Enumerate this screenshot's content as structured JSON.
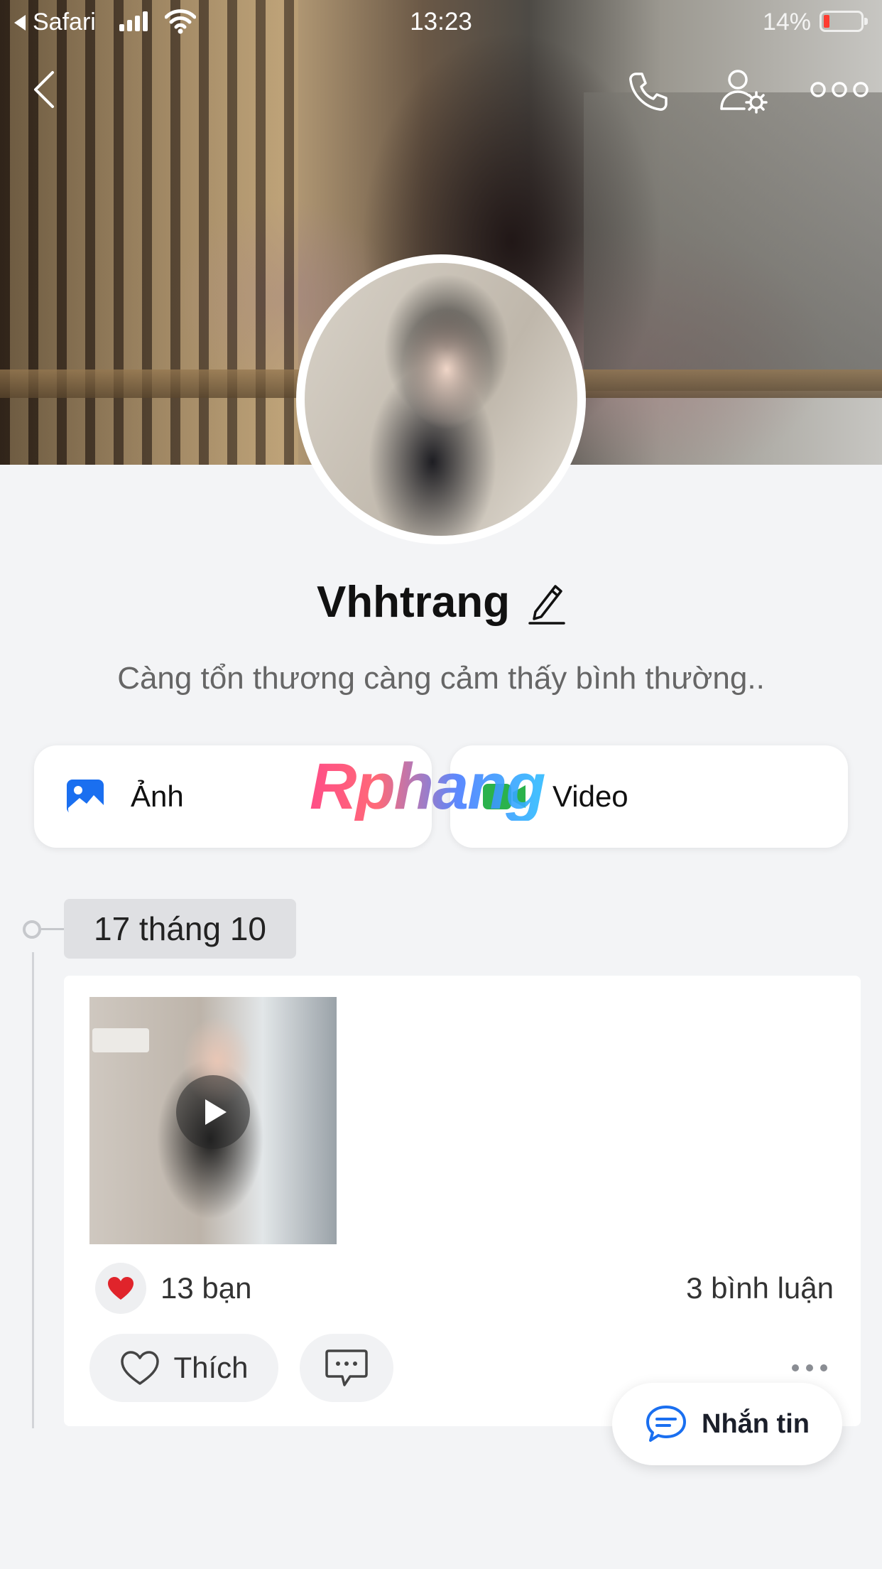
{
  "status_bar": {
    "back_app": "Safari",
    "time": "13:23",
    "battery_percent": "14%",
    "battery_level": 0.14
  },
  "nav": {
    "back_icon": "chevron-left-icon",
    "call_icon": "phone-icon",
    "settings_icon": "person-gear-icon",
    "more_icon": "more-dots-icon"
  },
  "profile": {
    "name": "Vhhtrang",
    "bio": "Càng tổn thương càng cảm thấy bình thường.."
  },
  "media_buttons": {
    "photo_label": "Ảnh",
    "video_label": "Video"
  },
  "watermark": "Rphang",
  "timeline": {
    "date": "17 tháng 10"
  },
  "post": {
    "reaction_count": "13 bạn",
    "reaction_icon": "heart",
    "comments": "3 bình luận",
    "like_label": "Thích"
  },
  "message_button": {
    "label": "Nhắn tin"
  },
  "colors": {
    "background": "#f3f4f6",
    "accent_blue": "#1a6ff0",
    "video_green": "#2bb24c",
    "heart_red": "#e0242b",
    "battery_red": "#ff3b30"
  }
}
